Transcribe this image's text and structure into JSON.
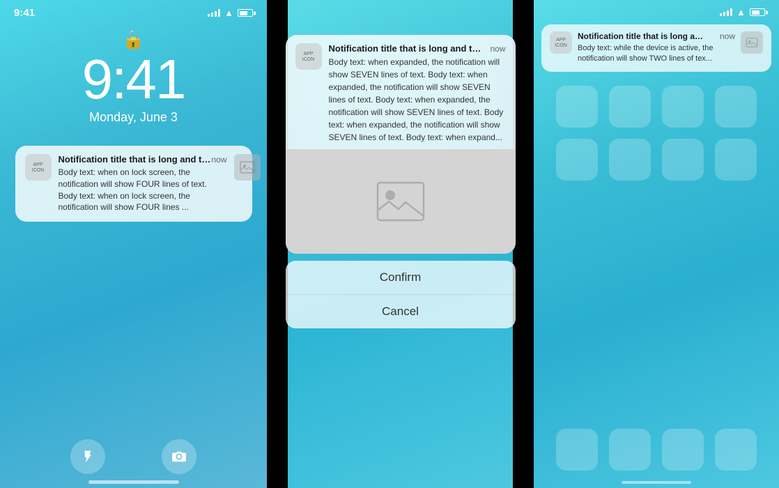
{
  "left": {
    "status_time": "9:41",
    "lock_time": "9:41",
    "lock_date": "Monday, June 3",
    "notification": {
      "app_label_line1": "APP",
      "app_label_line2": "ICON",
      "title": "Notification title that is long and trun...",
      "time": "now",
      "body": "Body text: when on lock screen, the notification will show FOUR lines of text. Body text: when on lock screen, the notification will show FOUR lines ..."
    },
    "bottom_icons": {
      "flashlight": "🔦",
      "camera": "📷"
    }
  },
  "middle": {
    "notification": {
      "app_label_line1": "APP",
      "app_label_line2": "ICON",
      "title": "Notification title that is long and trun...",
      "time": "now",
      "body": "Body text: when expanded, the notification will show SEVEN lines of text. Body text: when expanded, the notification will show SEVEN lines of text. Body text: when expanded, the notification will show SEVEN lines of text. Body text: when expanded, the notification will show SEVEN lines of text. Body text: when expand..."
    },
    "actions": {
      "confirm": "Confirm",
      "cancel": "Cancel"
    }
  },
  "right": {
    "status_time": "",
    "notification": {
      "app_label_line1": "APP",
      "app_label_line2": "ICON",
      "title": "Notification title that is long and trun...",
      "time": "now",
      "body": "Body text: while the device is active, the notification will show TWO lines of tex..."
    }
  }
}
